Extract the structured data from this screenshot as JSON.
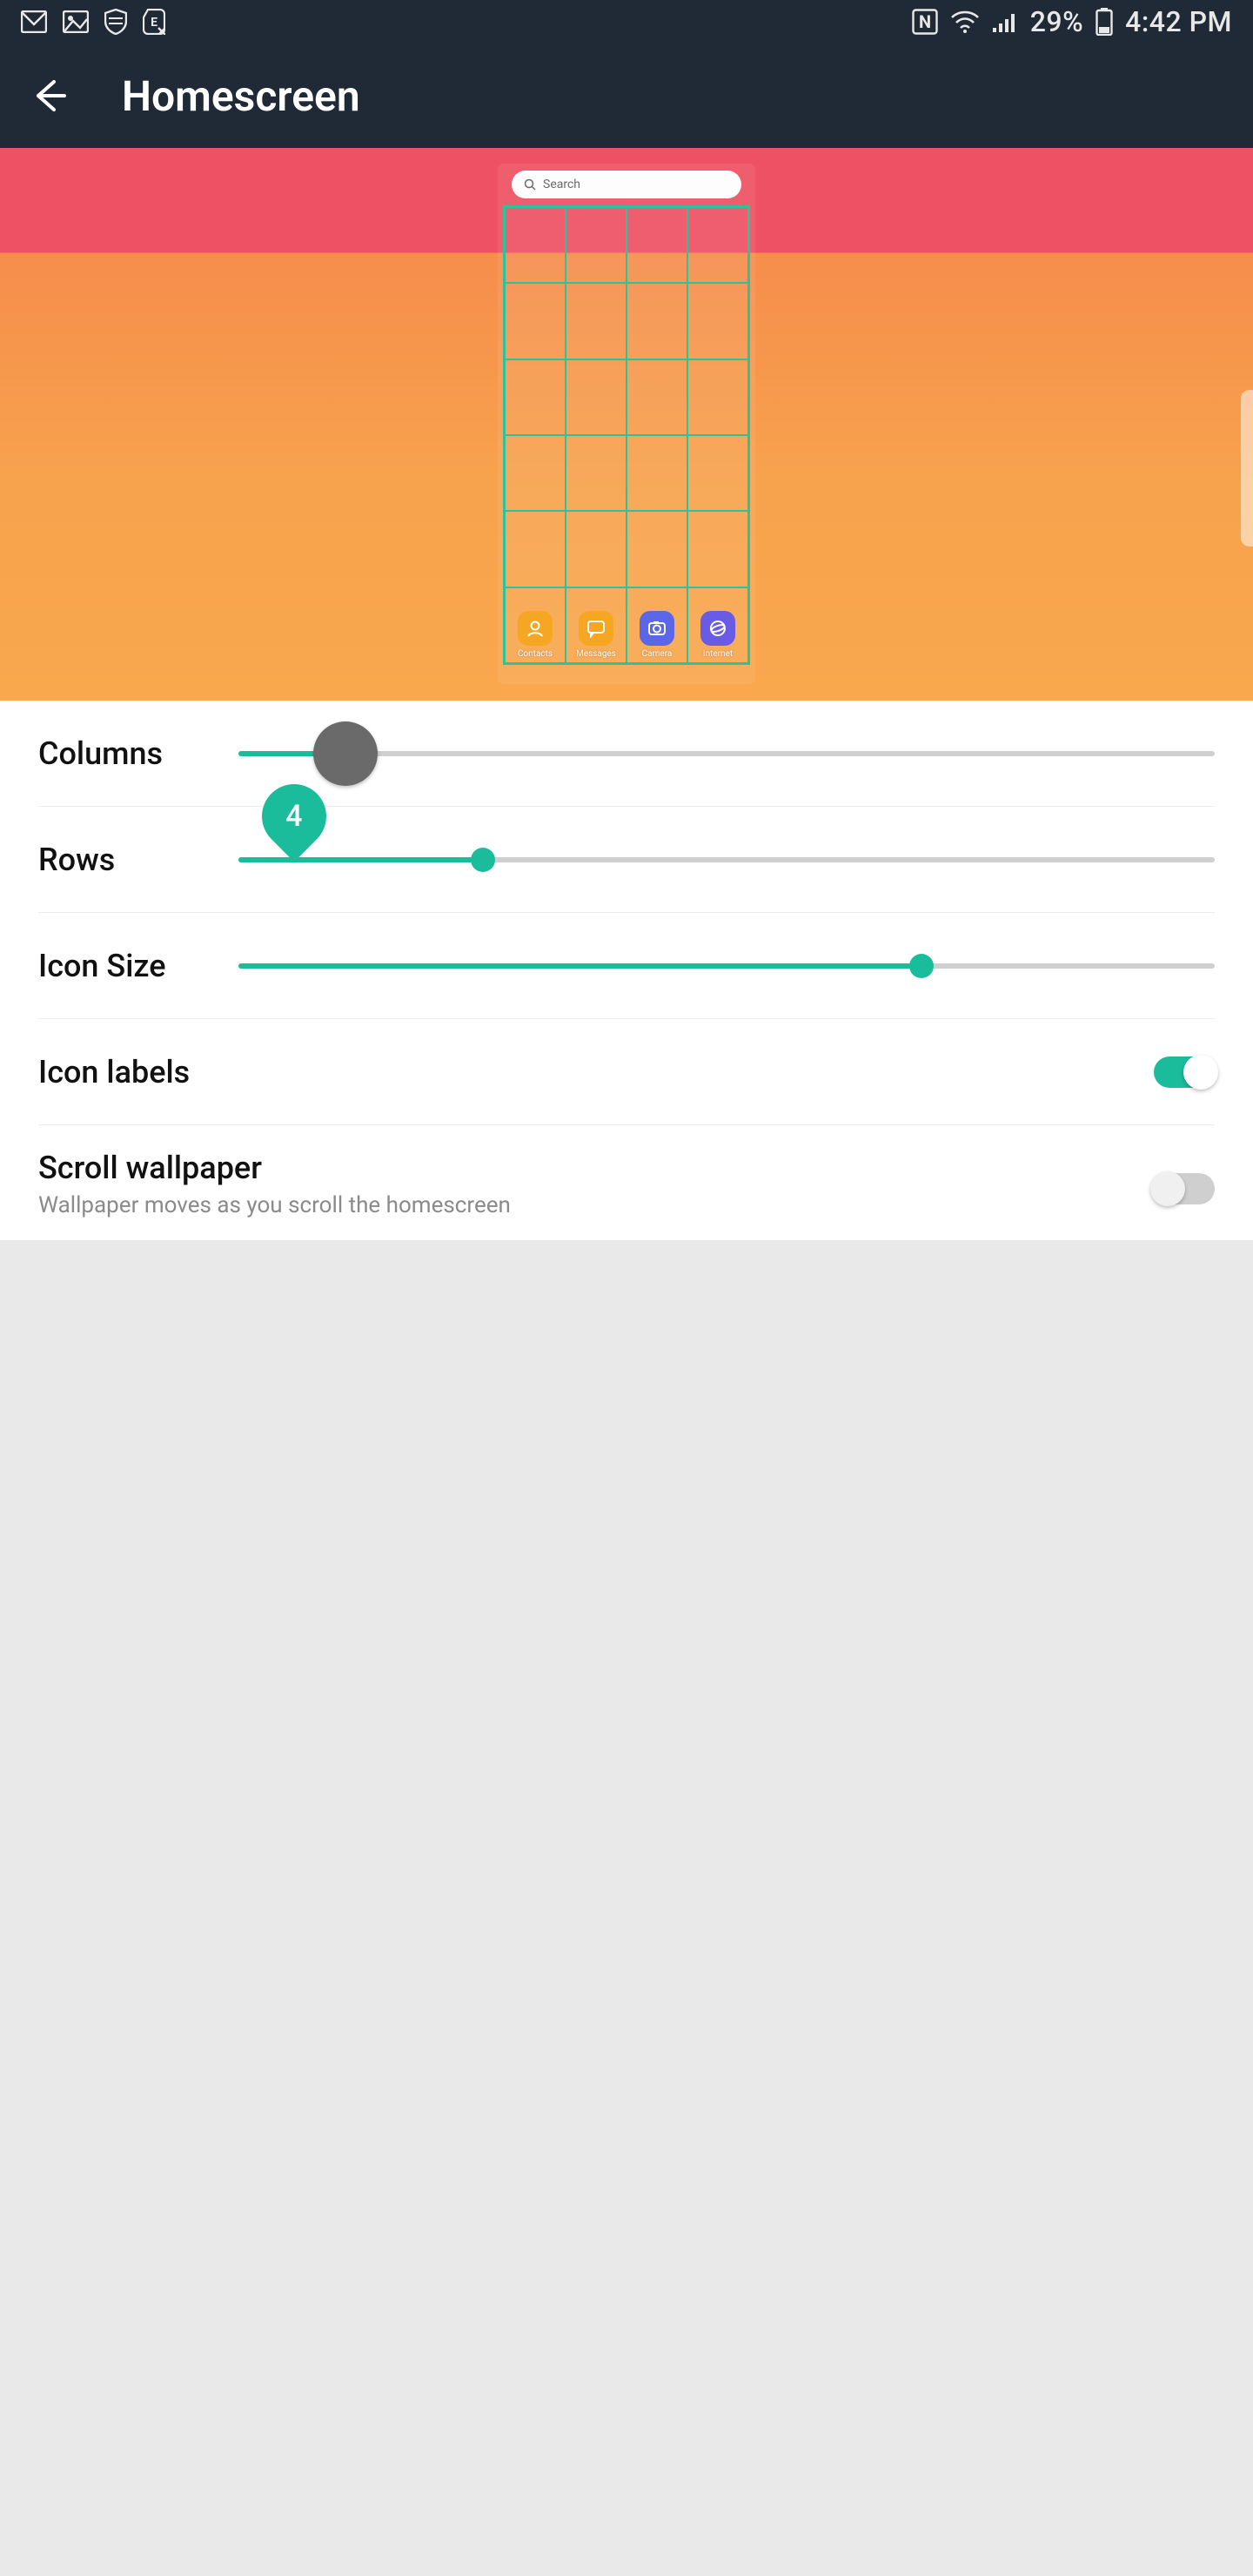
{
  "status": {
    "battery_pct": "29%",
    "time": "4:42 PM",
    "nfc_label": "N"
  },
  "appbar": {
    "title": "Homescreen"
  },
  "preview": {
    "search_placeholder": "Search",
    "columns": 4,
    "rows": 6,
    "dock": [
      {
        "label": "Contacts",
        "color": "#f5a623",
        "glyph": "contacts"
      },
      {
        "label": "Messages",
        "color": "#f5a623",
        "glyph": "messages"
      },
      {
        "label": "Camera",
        "color": "#5b67e6",
        "glyph": "camera"
      },
      {
        "label": "Internet",
        "color": "#6a5be6",
        "glyph": "internet"
      }
    ]
  },
  "slider_indicator_value": "4",
  "settings": {
    "columns": {
      "label": "Columns",
      "value": 4,
      "min": 3,
      "max": 12,
      "pct": 11
    },
    "rows": {
      "label": "Rows",
      "value": 6,
      "min": 3,
      "max": 12,
      "pct": 25
    },
    "icon_size": {
      "label": "Icon Size",
      "value": 70,
      "min": 0,
      "max": 100,
      "pct": 70
    },
    "icon_labels": {
      "label": "Icon labels",
      "on": true
    },
    "scroll_wallpaper": {
      "label": "Scroll wallpaper",
      "sub": "Wallpaper moves as you scroll the homescreen",
      "on": false
    }
  },
  "colors": {
    "accent": "#1abc9c",
    "appbar": "#1f2a36"
  }
}
